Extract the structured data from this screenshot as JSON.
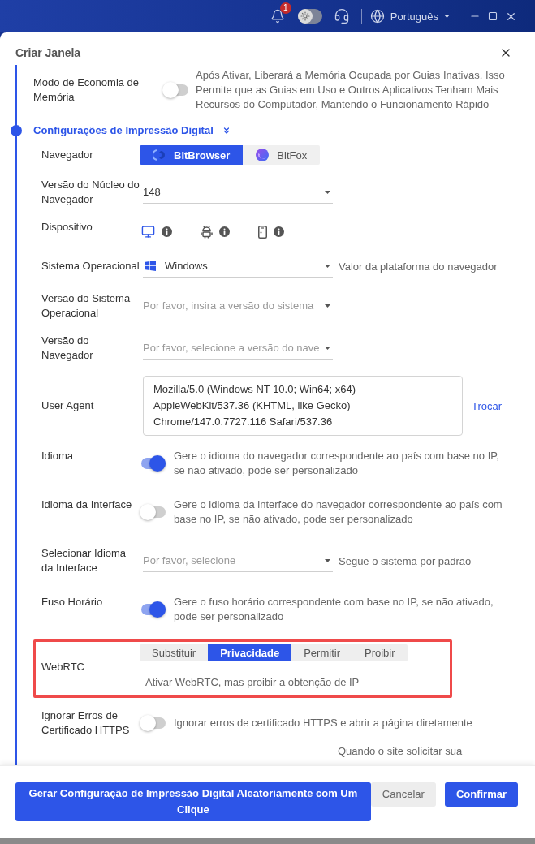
{
  "top_bar": {
    "notifications": "1",
    "theme_toggle": {
      "on": false
    },
    "language": "Português"
  },
  "dialog": {
    "title": "Criar Janela",
    "memory_saver": {
      "label": "Modo de Economia de Memória",
      "on": false,
      "description": "Após Ativar, Liberará a Memória Ocupada por Guias Inativas. Isso Permite que as Guias em Uso e Outros Aplicativos Tenham Mais Recursos do Computador, Mantendo o Funcionamento Rápido"
    },
    "section": {
      "title": "Configurações de Impressão Digital",
      "expanded": true
    },
    "fields": [
      {
        "kind": "browser",
        "label": "Navegador",
        "options": [
          {
            "label": "BitBrowser",
            "selected": true
          },
          {
            "label": "BitFox",
            "selected": false
          }
        ]
      },
      {
        "kind": "select",
        "label": "Versão do Núcleo do Navegador",
        "value": "148"
      },
      {
        "kind": "devices",
        "label": "Dispositivo",
        "options": [
          {
            "kind": "desktop",
            "selected": true
          },
          {
            "kind": "android",
            "selected": false
          },
          {
            "kind": "phone",
            "selected": false
          }
        ]
      },
      {
        "kind": "os_select",
        "label": "Sistema Operacional",
        "value": "Windows",
        "hint": "Valor da plataforma do navegador"
      },
      {
        "kind": "select",
        "label": "Versão do Sistema Operacional",
        "placeholder": "Por favor, insira a versão do sistema"
      },
      {
        "kind": "select",
        "label": "Versão do Navegador",
        "placeholder": "Por favor, selecione a versão do nave"
      },
      {
        "kind": "textarea",
        "label": "User Agent",
        "value": "Mozilla/5.0 (Windows NT 10.0; Win64; x64) AppleWebKit/537.36 (KHTML, like Gecko) Chrome/147.0.7727.116 Safari/537.36",
        "link": "Trocar"
      },
      {
        "kind": "toggle",
        "label": "Idioma",
        "on": true,
        "description": "Gere o idioma do navegador correspondente ao país com base no IP, se não ativado, pode ser personalizado"
      },
      {
        "kind": "toggle",
        "label": "Idioma da Interface",
        "on": false,
        "description": "Gere o idioma da interface do navegador correspondente ao país com base no IP, se não ativado, pode ser personalizado"
      },
      {
        "kind": "select",
        "label": "Selecionar Idioma da Interface",
        "placeholder": "Por favor, selecione",
        "hint": "Segue o sistema por padrão"
      },
      {
        "kind": "toggle",
        "label": "Fuso Horário",
        "on": true,
        "description": "Gere o fuso horário correspondente com base no IP, se não ativado, pode ser personalizado"
      },
      {
        "kind": "tabs",
        "label": "WebRTC",
        "highlighted": true,
        "options": [
          {
            "label": "Substituir",
            "selected": false
          },
          {
            "label": "Privacidade",
            "selected": true
          },
          {
            "label": "Permitir",
            "selected": false
          },
          {
            "label": "Proibir",
            "selected": false
          }
        ],
        "description": "Ativar WebRTC, mas proibir a obtenção de IP"
      },
      {
        "kind": "toggle",
        "label": "Ignorar Erros de Certificado HTTPS",
        "on": false,
        "description": "Ignorar erros de certificado HTTPS e abrir a página diretamente"
      },
      {
        "kind": "note",
        "text": "Quando o site solicitar sua"
      }
    ],
    "buttons": [
      {
        "kind": "primary",
        "label": "Gerar Configuração de Impressão Digital Aleatoriamente com Um Clique"
      },
      {
        "kind": "secondary",
        "label": "Cancelar"
      },
      {
        "kind": "primary",
        "label": "Confirmar"
      }
    ]
  }
}
